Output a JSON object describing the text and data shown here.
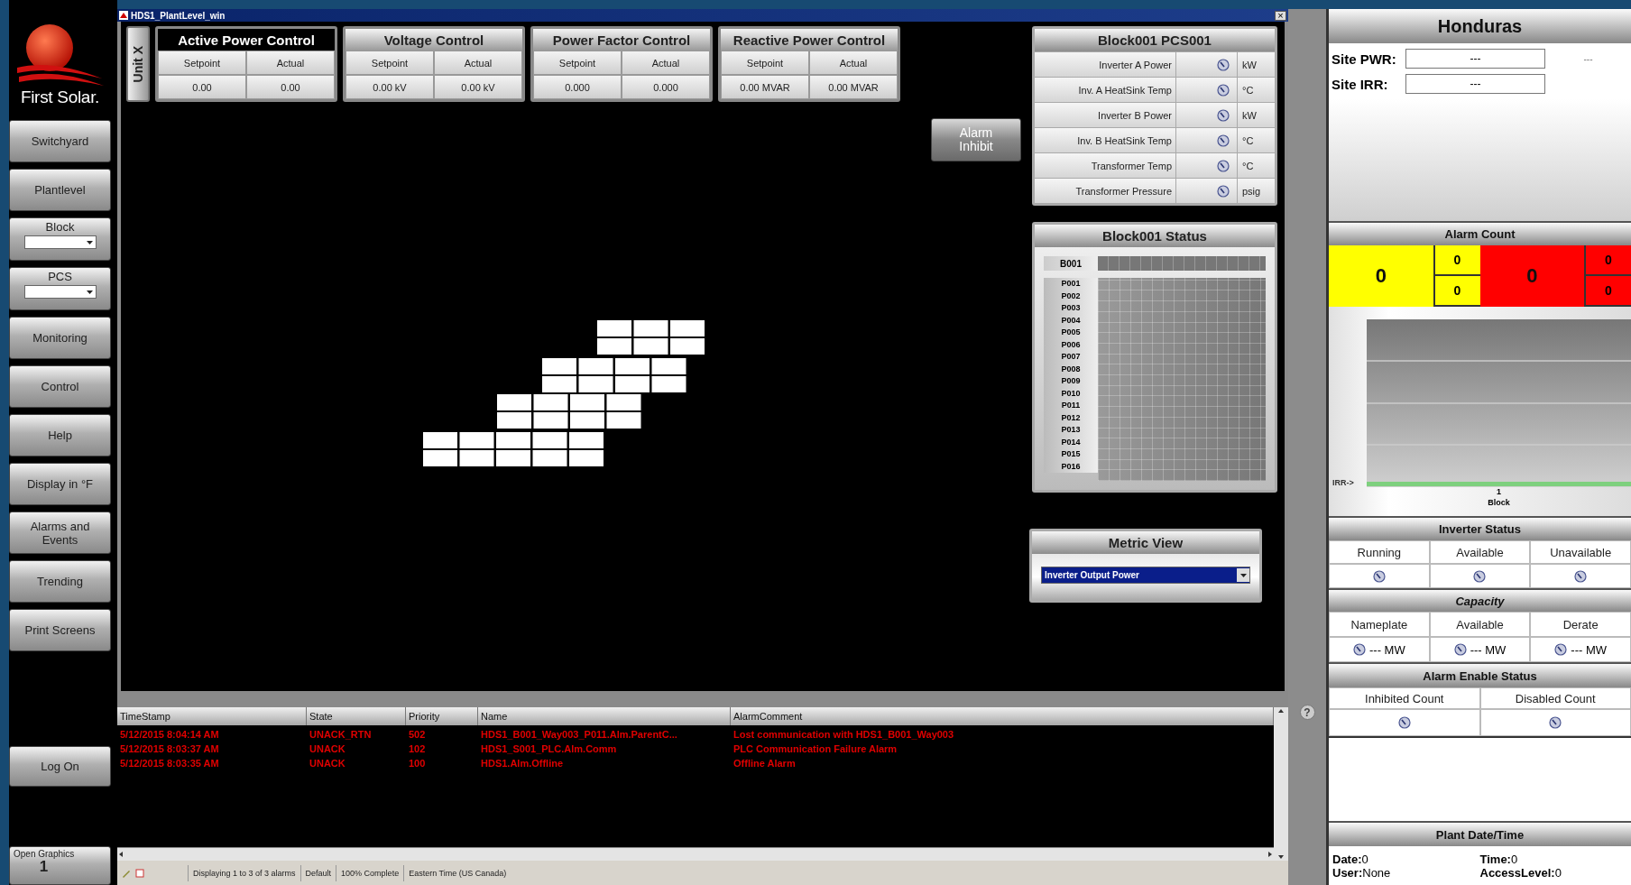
{
  "logo": {
    "text": "First Solar."
  },
  "nav": [
    {
      "kind": "button",
      "label": "Switchyard"
    },
    {
      "kind": "button",
      "label": "Plantlevel"
    },
    {
      "kind": "dropdown",
      "label": "Block"
    },
    {
      "kind": "dropdown",
      "label": "PCS"
    },
    {
      "kind": "button",
      "label": "Monitoring"
    },
    {
      "kind": "button",
      "label": "Control"
    },
    {
      "kind": "button",
      "label": "Help"
    },
    {
      "kind": "button",
      "label": "Display in °F"
    },
    {
      "kind": "button",
      "label": "Alarms and Events"
    },
    {
      "kind": "button",
      "label": "Trending"
    },
    {
      "kind": "button",
      "label": "Print Screens"
    }
  ],
  "log_on": "Log On",
  "open_graphics": {
    "label": "Open Graphics",
    "count": "1"
  },
  "window": {
    "title": "HDS1_PlantLevel_win",
    "close_glyph": "×"
  },
  "unit_tab": "Unit X",
  "controls": [
    {
      "title": "Active Power Control",
      "selected": true,
      "setpoint_label": "Setpoint",
      "actual_label": "Actual",
      "setpoint": "0.00",
      "actual": "0.00"
    },
    {
      "title": "Voltage Control",
      "selected": false,
      "setpoint_label": "Setpoint",
      "actual_label": "Actual",
      "setpoint": "0.00 kV",
      "actual": "0.00 kV"
    },
    {
      "title": "Power Factor Control",
      "selected": false,
      "setpoint_label": "Setpoint",
      "actual_label": "Actual",
      "setpoint": "0.000",
      "actual": "0.000"
    },
    {
      "title": "Reactive Power Control",
      "selected": false,
      "setpoint_label": "Setpoint",
      "actual_label": "Actual",
      "setpoint": "0.00 MVAR",
      "actual": "0.00 MVAR"
    }
  ],
  "alarm_inhibit_button": "Alarm Inhibit",
  "pcs_panel": {
    "title": "Block001 PCS001",
    "rows": [
      {
        "label": "Inverter A Power",
        "unit": "kW"
      },
      {
        "label": "Inv. A HeatSink Temp",
        "unit": "°C"
      },
      {
        "label": "Inverter B Power",
        "unit": "kW"
      },
      {
        "label": "Inv. B HeatSink Temp",
        "unit": "°C"
      },
      {
        "label": "Transformer Temp",
        "unit": "°C"
      },
      {
        "label": "Transformer Pressure",
        "unit": "psig"
      }
    ]
  },
  "block_status": {
    "title": "Block001 Status",
    "block": "B001",
    "rows": [
      "P001",
      "P002",
      "P003",
      "P004",
      "P005",
      "P006",
      "P007",
      "P008",
      "P009",
      "P010",
      "P011",
      "P012",
      "P013",
      "P014",
      "P015",
      "P016"
    ]
  },
  "metric_view": {
    "title": "Metric View",
    "value": "Inverter Output Power"
  },
  "alarms": {
    "columns": [
      "TimeStamp",
      "State",
      "Priority",
      "Name",
      "AlarmComment"
    ],
    "rows": [
      [
        "5/12/2015 8:04:14 AM",
        "UNACK_RTN",
        "502",
        "HDS1_B001_Way003_P011.Alm.ParentC...",
        "Lost communication with HDS1_B001_Way003"
      ],
      [
        "5/12/2015 8:03:37 AM",
        "UNACK",
        "102",
        "HDS1_S001_PLC.Alm.Comm",
        "PLC Communication Failure Alarm"
      ],
      [
        "5/12/2015 8:03:35 AM",
        "UNACK",
        "100",
        "HDS1.Alm.Offline",
        "Offline Alarm"
      ]
    ]
  },
  "help_glyph": "?",
  "status_bar": [
    "Displaying 1 to 3 of 3 alarms",
    "Default",
    "100% Complete",
    "Eastern Time (US  Canada)"
  ],
  "site": {
    "title": "Honduras",
    "fields": [
      {
        "label": "Site PWR:",
        "value": "---"
      },
      {
        "label": "Site IRR:",
        "value": "---"
      }
    ],
    "extra": "---"
  },
  "alarm_count": {
    "title": "Alarm Count",
    "groups": [
      {
        "color": "#ffff00",
        "total": "0",
        "sub": [
          "0",
          "0"
        ]
      },
      {
        "color": "#ff0000",
        "total": "0",
        "sub": [
          "0",
          "0"
        ]
      }
    ]
  },
  "irr_plot": {
    "marker_label": "IRR->",
    "tick": "1",
    "xlabel": "Block"
  },
  "inverter_status": {
    "title": "Inverter Status",
    "columns": [
      "Running",
      "Available",
      "Unavailable"
    ]
  },
  "capacity": {
    "title": "Capacity",
    "columns": [
      {
        "label": "Nameplate",
        "value": "--- MW"
      },
      {
        "label": "Available",
        "value": "--- MW"
      },
      {
        "label": "Derate",
        "value": "--- MW"
      }
    ]
  },
  "alarm_enable": {
    "title": "Alarm Enable Status",
    "columns": [
      "Inhibited Count",
      "Disabled Count"
    ]
  },
  "plant_datetime": {
    "title": "Plant Date/Time",
    "fields": [
      {
        "label": "Date:",
        "value": "0"
      },
      {
        "label": "Time:",
        "value": "0"
      },
      {
        "label": "User:",
        "value": "None"
      },
      {
        "label": "AccessLevel:",
        "value": "0"
      }
    ]
  }
}
